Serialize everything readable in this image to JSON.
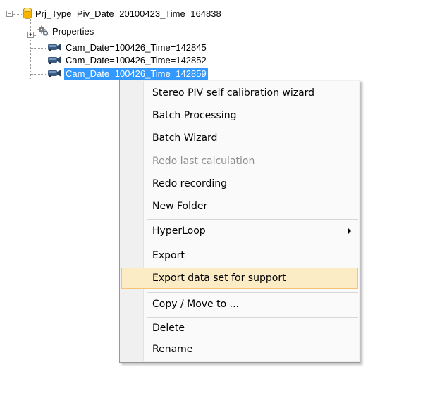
{
  "tree": {
    "root_label": "Prj_Type=Piv_Date=20100423_Time=164838",
    "properties_label": "Properties",
    "cameras": [
      "Cam_Date=100426_Time=142845",
      "Cam_Date=100426_Time=142852",
      "Cam_Date=100426_Time=142859"
    ]
  },
  "context_menu": {
    "items": [
      {
        "label": "Stereo PIV self calibration wizard"
      },
      {
        "label": "Batch Processing"
      },
      {
        "label": "Batch Wizard"
      },
      {
        "label": "Redo last calculation"
      },
      {
        "label": "Redo recording"
      },
      {
        "label": "New Folder"
      },
      {
        "label": "HyperLoop"
      },
      {
        "label": "Export"
      },
      {
        "label": "Export data set for support"
      },
      {
        "label": "Copy / Move to ..."
      },
      {
        "label": "Delete"
      },
      {
        "label": "Rename"
      }
    ]
  },
  "colors": {
    "selection": "#3399ff",
    "menu_hover": "#fcecc6",
    "menu_hover_border": "#f5c376",
    "disabled_text": "#8d8d8d"
  }
}
